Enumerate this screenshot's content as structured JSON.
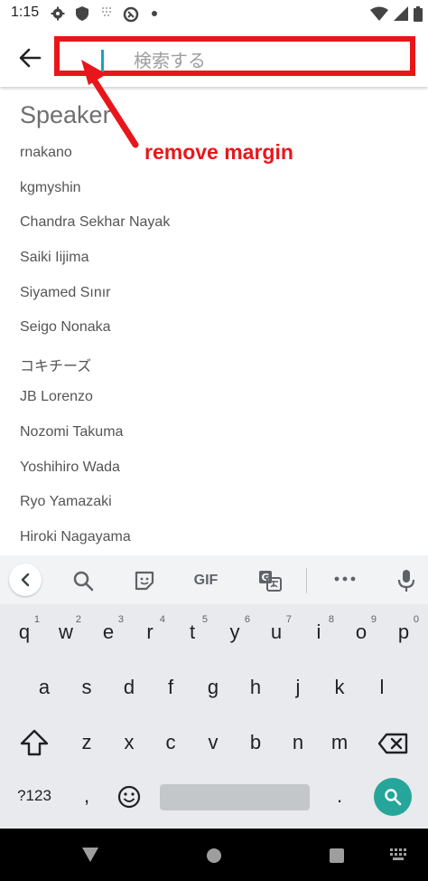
{
  "status": {
    "time": "1:15"
  },
  "search": {
    "placeholder": "検索する"
  },
  "list": {
    "title": "Speaker",
    "items": [
      "rnakano",
      "kgmyshin",
      "Chandra Sekhar Nayak",
      "Saiki Iijima",
      "Siyamed Sınır",
      "Seigo Nonaka",
      "コキチーズ",
      "JB Lorenzo",
      "Nozomi Takuma",
      "Yoshihiro Wada",
      "Ryo Yamazaki",
      "Hiroki Nagayama"
    ]
  },
  "annotation": {
    "text": "remove margin",
    "color": "#e8161b"
  },
  "keyboard": {
    "toolbar": {
      "gif_label": "GIF"
    },
    "row1": [
      {
        "key": "q",
        "hint": "1"
      },
      {
        "key": "w",
        "hint": "2"
      },
      {
        "key": "e",
        "hint": "3"
      },
      {
        "key": "r",
        "hint": "4"
      },
      {
        "key": "t",
        "hint": "5"
      },
      {
        "key": "y",
        "hint": "6"
      },
      {
        "key": "u",
        "hint": "7"
      },
      {
        "key": "i",
        "hint": "8"
      },
      {
        "key": "o",
        "hint": "9"
      },
      {
        "key": "p",
        "hint": "0"
      }
    ],
    "row2": [
      "a",
      "s",
      "d",
      "f",
      "g",
      "h",
      "j",
      "k",
      "l"
    ],
    "row3": [
      "z",
      "x",
      "c",
      "v",
      "b",
      "n",
      "m"
    ],
    "symbols_label": "?123",
    "comma": ",",
    "period": "."
  },
  "colors": {
    "accent": "#1aa3c4",
    "search_key": "#26a69a",
    "annotation": "#e8161b"
  }
}
